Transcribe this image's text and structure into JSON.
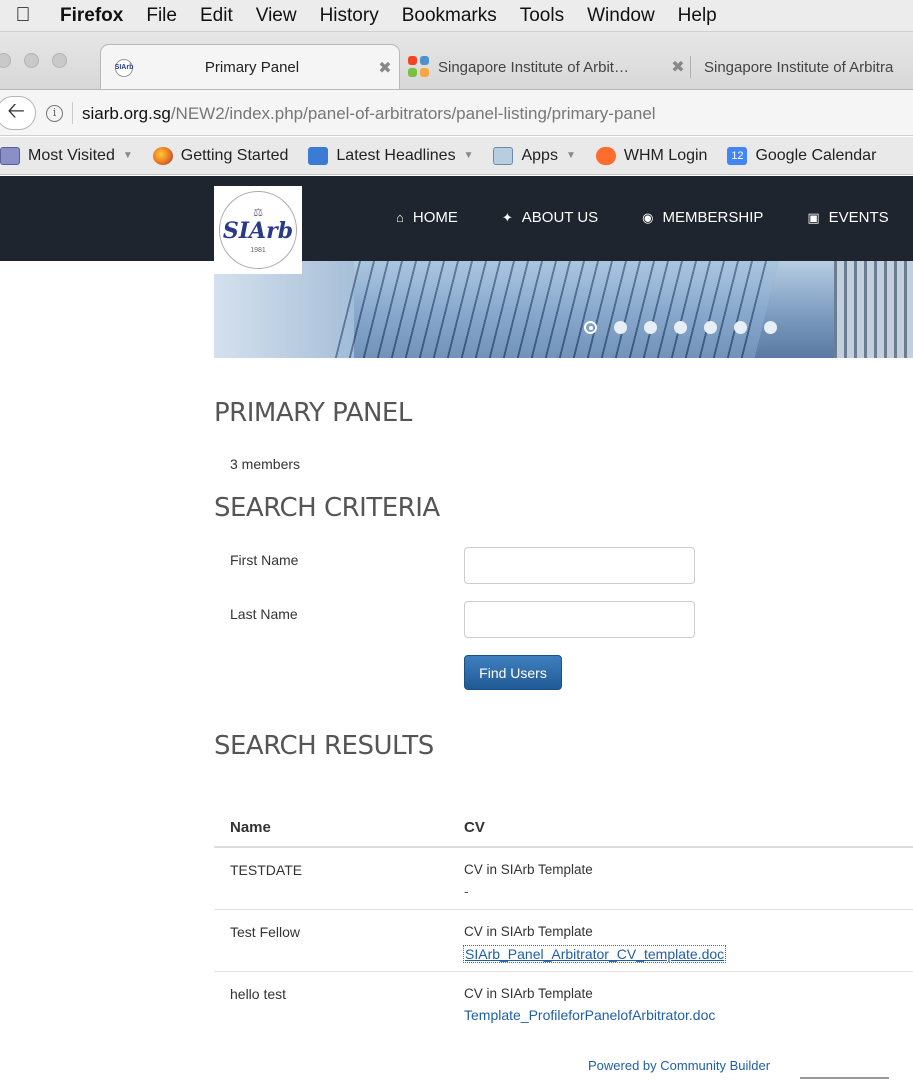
{
  "menubar": {
    "items": [
      "Firefox",
      "File",
      "Edit",
      "View",
      "History",
      "Bookmarks",
      "Tools",
      "Window",
      "Help"
    ]
  },
  "tabs": [
    {
      "title": "Primary Panel",
      "active": true
    },
    {
      "title": "Singapore Institute of Arbit…",
      "active": false
    },
    {
      "title": "Singapore Institute of Arbitra",
      "active": false
    }
  ],
  "address": {
    "domain": "siarb.org.sg",
    "path": "/NEW2/index.php/panel-of-arbitrators/panel-listing/primary-panel"
  },
  "bookmarks": [
    {
      "label": "Most Visited",
      "icon": "most-visited-icon",
      "dropdown": true
    },
    {
      "label": "Getting Started",
      "icon": "firefox-icon",
      "dropdown": false
    },
    {
      "label": "Latest Headlines",
      "icon": "rss-icon",
      "dropdown": true
    },
    {
      "label": "Apps",
      "icon": "folder-icon",
      "dropdown": true
    },
    {
      "label": "WHM Login",
      "icon": "cpanel-icon",
      "dropdown": false
    },
    {
      "label": "Google Calendar",
      "icon": "calendar-icon",
      "dropdown": false,
      "badge": "12"
    }
  ],
  "site": {
    "logo_text": "SIArb",
    "logo_year": "1981",
    "nav": [
      {
        "label": "HOME",
        "icon": "home-icon"
      },
      {
        "label": "ABOUT US",
        "icon": "magic-wand-icon"
      },
      {
        "label": "MEMBERSHIP",
        "icon": "globe-icon"
      },
      {
        "label": "EVENTS",
        "icon": "gift-icon"
      }
    ],
    "slider": {
      "count": 7,
      "active": 1
    }
  },
  "page": {
    "title": "PRIMARY PANEL",
    "member_count": "3 members",
    "search_heading": "SEARCH CRITERIA",
    "first_name_label": "First Name",
    "first_name_value": "",
    "last_name_label": "Last Name",
    "last_name_value": "",
    "find_button": "Find Users",
    "results_heading": "SEARCH RESULTS"
  },
  "results": {
    "columns": [
      "Name",
      "CV"
    ],
    "rows": [
      {
        "name": "TESTDATE",
        "cv_label": "CV in SIArb Template",
        "cv_value": "-"
      },
      {
        "name": "Test Fellow",
        "cv_label": "CV in SIArb Template",
        "cv_value": "SIArb_Panel_Arbitrator_CV_template.doc"
      },
      {
        "name": "hello test",
        "cv_label": "CV in SIArb Template",
        "cv_value": "Template_ProfileforPanelofArbitrator.doc"
      }
    ]
  },
  "footer": {
    "powered_by": "Powered by Community Builder"
  },
  "colors": {
    "header_bg": "#1f252e",
    "link": "#1f5fa8",
    "button": "#2a6aa8"
  }
}
